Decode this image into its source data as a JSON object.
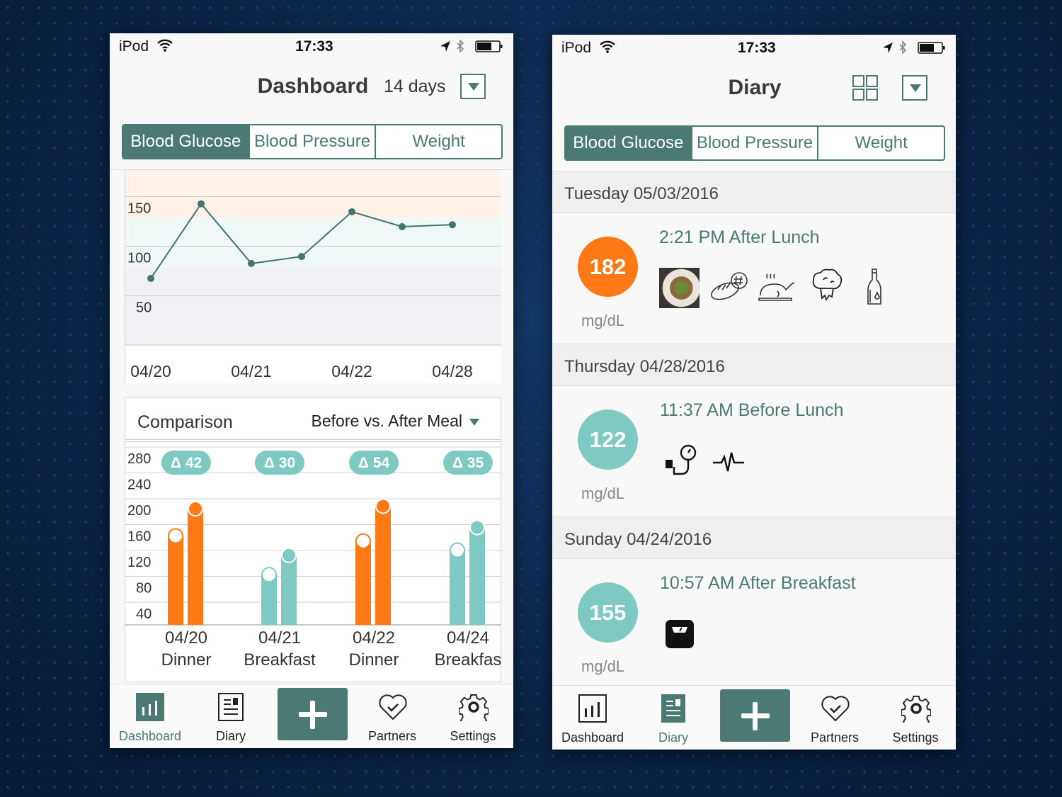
{
  "status_bar": {
    "carrier": "iPod",
    "time": "17:33"
  },
  "colors": {
    "accent": "#4a7a72",
    "teal": "#7ecac3",
    "orange": "#ff7a17"
  },
  "segments": [
    "Blood Glucose",
    "Blood Pressure",
    "Weight"
  ],
  "dashboard": {
    "title": "Dashboard",
    "range": "14 days",
    "comparison": {
      "title": "Comparison",
      "mode": "Before vs. After Meal"
    }
  },
  "diary": {
    "title": "Diary",
    "sections": [
      {
        "date": "Tuesday 05/03/2016",
        "entry": {
          "value": "182",
          "unit": "mg/dL",
          "title": "2:21 PM After Lunch",
          "level": "high",
          "icons": [
            "meal-photo",
            "bread-icon",
            "chicken-icon",
            "broccoli-icon",
            "bottle-icon"
          ]
        }
      },
      {
        "date": "Thursday 04/28/2016",
        "entry": {
          "value": "122",
          "unit": "mg/dL",
          "title": "11:37 AM Before Lunch",
          "level": "normal",
          "icons": [
            "blood-pressure-icon",
            "heartbeat-icon"
          ]
        }
      },
      {
        "date": "Sunday 04/24/2016",
        "entry": {
          "value": "155",
          "unit": "mg/dL",
          "title": "10:57 AM After Breakfast",
          "level": "normal",
          "icons": [
            "scale-icon"
          ]
        }
      }
    ]
  },
  "tabs": {
    "dashboard_screen": {
      "active": "Dashboard"
    },
    "diary_screen": {
      "active": "Diary"
    },
    "labels": [
      "Dashboard",
      "Diary",
      "Partners",
      "Settings"
    ]
  },
  "chart_data": [
    {
      "type": "line",
      "yticks": [
        150,
        100,
        50
      ],
      "ylim": [
        12,
        188
      ],
      "x_labels": [
        "04/20",
        "",
        "04/21",
        "",
        "04/22",
        "",
        "04/28"
      ],
      "values": [
        79,
        154,
        94,
        101,
        146,
        131,
        133
      ],
      "bands": {
        "high_above": 140,
        "target": [
          90,
          140
        ]
      },
      "grid": true
    },
    {
      "type": "bar",
      "yticks": [
        280,
        240,
        200,
        160,
        120,
        80,
        40
      ],
      "categories": [
        [
          "04/20",
          "Dinner"
        ],
        [
          "04/21",
          "Breakfast"
        ],
        [
          "04/22",
          "Dinner"
        ],
        [
          "04/24",
          "Breakfas"
        ]
      ],
      "series": [
        {
          "values": [
            160,
            100,
            152,
            138
          ]
        },
        {
          "values": [
            202,
            130,
            206,
            173
          ]
        }
      ],
      "deltas": [
        "Δ 42",
        "Δ 30",
        "Δ 54",
        "Δ 35"
      ],
      "level": [
        "high",
        "normal",
        "high",
        "normal"
      ],
      "grid": true
    }
  ]
}
